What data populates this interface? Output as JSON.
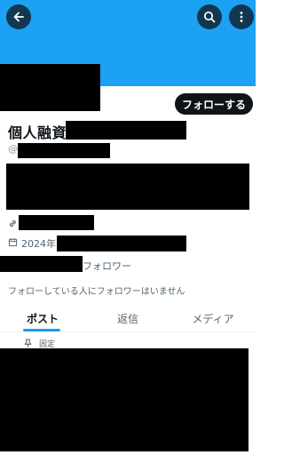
{
  "header": {
    "back_icon": "arrow-left-icon",
    "search_icon": "search-icon",
    "more_icon": "more-vertical-icon",
    "banner_color": "#1da1f2"
  },
  "profile": {
    "follow_label": "フォローする",
    "name_visible": "個人融資",
    "handle_prefix": "@",
    "link_icon": "link-icon",
    "joined_icon": "calendar-icon",
    "joined_prefix": "2024年",
    "followers_label": "フォロワー",
    "mutual_note": "フォローしている人にフォロワーはいません"
  },
  "tabs": [
    {
      "label": "ポスト",
      "active": true
    },
    {
      "label": "返信",
      "active": false
    },
    {
      "label": "メディア",
      "active": false
    }
  ],
  "pinned": {
    "icon": "pin-icon",
    "label": "固定"
  },
  "colors": {
    "accent": "#1d9bf0",
    "text": "#0f1419",
    "muted": "#536471"
  }
}
